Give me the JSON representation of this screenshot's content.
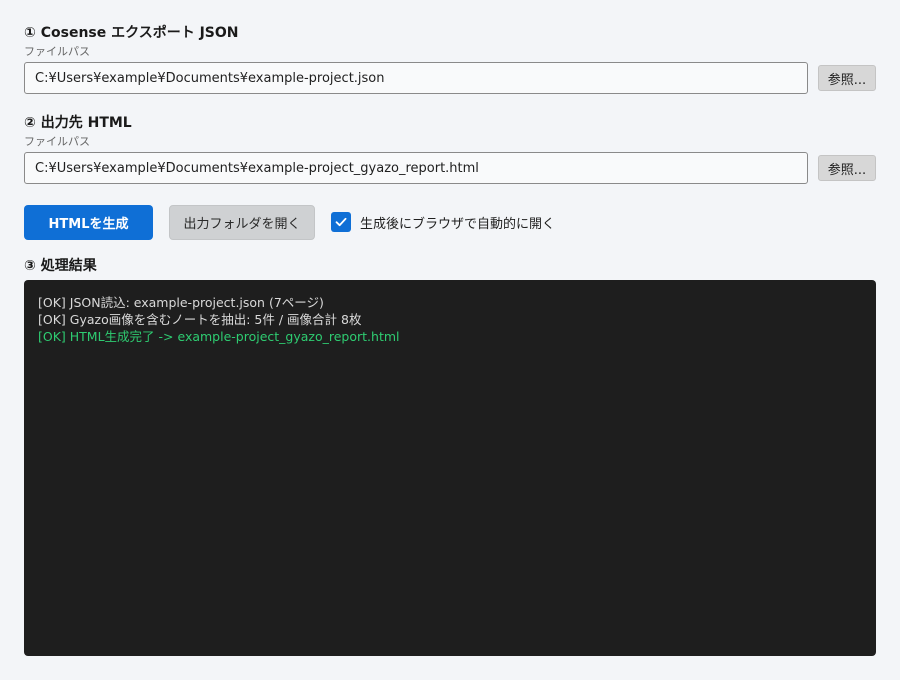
{
  "source": {
    "title": "① Cosense エクスポート JSON",
    "sub_label": "ファイルパス",
    "path_value": "C:¥Users¥example¥Documents¥example-project.json",
    "browse_label": "参照..."
  },
  "output": {
    "title": "② 出力先 HTML",
    "sub_label": "ファイルパス",
    "path_value": "C:¥Users¥example¥Documents¥example-project_gyazo_report.html",
    "browse_label": "参照..."
  },
  "actions": {
    "generate_label": "HTMLを生成",
    "open_folder_label": "出力フォルダを開く",
    "auto_open_label": "生成後にブラウザで自動的に開く",
    "auto_open_checked": true
  },
  "result": {
    "title": "③ 処理結果",
    "log_lines": [
      {
        "text": "[OK] JSON読込: example-project.json (7ページ)",
        "status": "info"
      },
      {
        "text": "[OK] Gyazo画像を含むノートを抽出: 5件 / 画像合計 8枚",
        "status": "info"
      },
      {
        "text": "[OK] HTML生成完了 -> example-project_gyazo_report.html",
        "status": "success"
      }
    ]
  },
  "colors": {
    "accent": "#0f6fd6",
    "log_background": "#1e1e1e",
    "log_text": "#d9d9d9",
    "log_success": "#2ecc71"
  }
}
